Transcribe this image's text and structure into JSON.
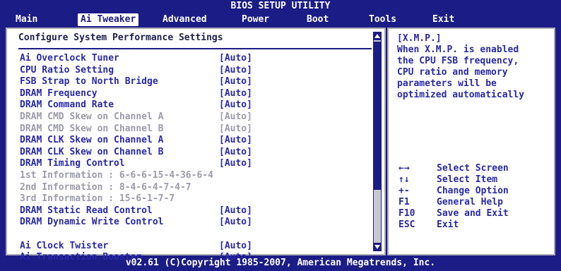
{
  "title": "BIOS SETUP UTILITY",
  "menu": {
    "items": [
      {
        "label": "Main"
      },
      {
        "label": "Ai Tweaker"
      },
      {
        "label": "Advanced"
      },
      {
        "label": "Power"
      },
      {
        "label": "Boot"
      },
      {
        "label": "Tools"
      },
      {
        "label": "Exit"
      }
    ],
    "active": "Ai Tweaker"
  },
  "main": {
    "heading": "Configure System Performance Settings",
    "rows": [
      {
        "label": "Ai Overclock Tuner",
        "value": "[Auto]",
        "state": "enabled"
      },
      {
        "label": "CPU Ratio Setting",
        "value": "[Auto]",
        "state": "enabled"
      },
      {
        "label": "FSB Strap to North Bridge",
        "value": "[Auto]",
        "state": "enabled"
      },
      {
        "label": "DRAM Frequency",
        "value": "[Auto]",
        "state": "enabled"
      },
      {
        "label": "DRAM Command Rate",
        "value": "[Auto]",
        "state": "enabled"
      },
      {
        "label": "DRAM CMD Skew on Channel A",
        "value": "[Auto]",
        "state": "disabled"
      },
      {
        "label": "DRAM CMD Skew on Channel B",
        "value": "[Auto]",
        "state": "disabled"
      },
      {
        "label": "DRAM CLK Skew on Channel A",
        "value": "[Auto]",
        "state": "enabled"
      },
      {
        "label": "DRAM CLK Skew on Channel B",
        "value": "[Auto]",
        "state": "enabled"
      },
      {
        "label": "DRAM Timing Control",
        "value": "[Auto]",
        "state": "enabled"
      },
      {
        "label": "1st Information : 6-6-6-15-4-36-6-4",
        "value": "",
        "state": "info"
      },
      {
        "label": "2nd Information : 8-4-6-4-7-4-7",
        "value": "",
        "state": "info"
      },
      {
        "label": "3rd Information : 15-6-1-7-7",
        "value": "",
        "state": "info"
      },
      {
        "label": "DRAM Static Read Control",
        "value": "[Auto]",
        "state": "enabled"
      },
      {
        "label": "DRAM Dynamic Write Control",
        "value": "[Auto]",
        "state": "enabled"
      },
      {
        "label": "",
        "value": "",
        "state": "blank"
      },
      {
        "label": "Ai Clock Twister",
        "value": "[Auto]",
        "state": "enabled"
      },
      {
        "label": "Ai Transaction Booster",
        "value": "[Auto]",
        "state": "enabled"
      }
    ]
  },
  "help": {
    "lines": [
      "[X.M.P.]",
      "When X.M.P. is enabled",
      "the CPU FSB frequency,",
      "CPU ratio and memory",
      "parameters will be",
      "optimized automatically"
    ]
  },
  "keys": [
    {
      "key": "←→",
      "desc": "Select Screen"
    },
    {
      "key": "↑↓",
      "desc": "Select Item"
    },
    {
      "key": "+-",
      "desc": "Change Option"
    },
    {
      "key": "F1",
      "desc": "General Help"
    },
    {
      "key": "F10",
      "desc": "Save and Exit"
    },
    {
      "key": "ESC",
      "desc": "Exit"
    }
  ],
  "footer": "v02.61 (C)Copyright 1985-2007, American Megatrends, Inc.",
  "colors": {
    "background": "#1c1c86",
    "panel": "#ffffff",
    "text_enabled": "#2929a8",
    "text_disabled": "#9c9caa",
    "heading": "#1e1e4c"
  }
}
